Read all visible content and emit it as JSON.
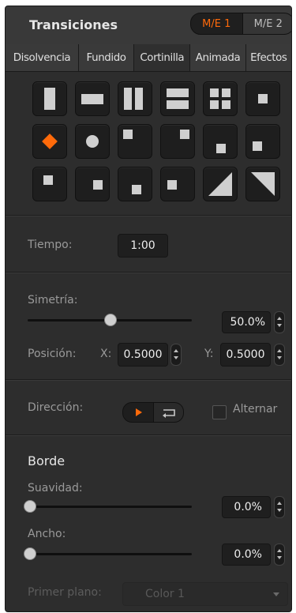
{
  "header": {
    "title": "Transiciones",
    "me_buttons": [
      "M/E 1",
      "M/E 2"
    ]
  },
  "tabs": [
    "Disolvencia",
    "Fundido",
    "Cortinilla",
    "Animada",
    "Efectos"
  ],
  "active_tab_index": 2,
  "tile_icons": [
    "wipe-vertical-bar-icon",
    "wipe-horizontal-bar-icon",
    "wipe-split-vertical-icon",
    "wipe-split-horizontal-icon",
    "wipe-four-box-icon",
    "wipe-box-center-icon",
    "wipe-diamond-icon",
    "wipe-circle-icon",
    "wipe-corner-top-left-icon",
    "wipe-corner-top-right-icon",
    "wipe-corner-bottom-center-icon",
    "wipe-corner-bottom-right-icon",
    "wipe-box-left-icon",
    "wipe-box-right-icon",
    "wipe-box-bottom-icon",
    "wipe-box-middle-icon",
    "wipe-diagonal-bottom-left-icon",
    "wipe-diagonal-top-right-icon"
  ],
  "selected_tile_index": 6,
  "accent_color": "#ff6a0a",
  "time": {
    "label": "Tiempo:",
    "value": "1:00"
  },
  "symmetry": {
    "label": "Simetría:",
    "value": "50.0%",
    "level": 0.5
  },
  "position": {
    "label": "Posición:",
    "x_label": "X:",
    "x_value": "0.5000",
    "y_label": "Y:",
    "y_value": "0.5000"
  },
  "direction": {
    "label": "Dirección:",
    "alternate_label": "Alternar",
    "alternate_checked": false,
    "active": "normal"
  },
  "border": {
    "title": "Borde",
    "softness": {
      "label": "Suavidad:",
      "value": "0.0%",
      "level": 0.0
    },
    "width": {
      "label": "Ancho:",
      "value": "0.0%",
      "level": 0.0
    },
    "fill_label": "Primer plano:",
    "fill_value": "Color 1"
  }
}
